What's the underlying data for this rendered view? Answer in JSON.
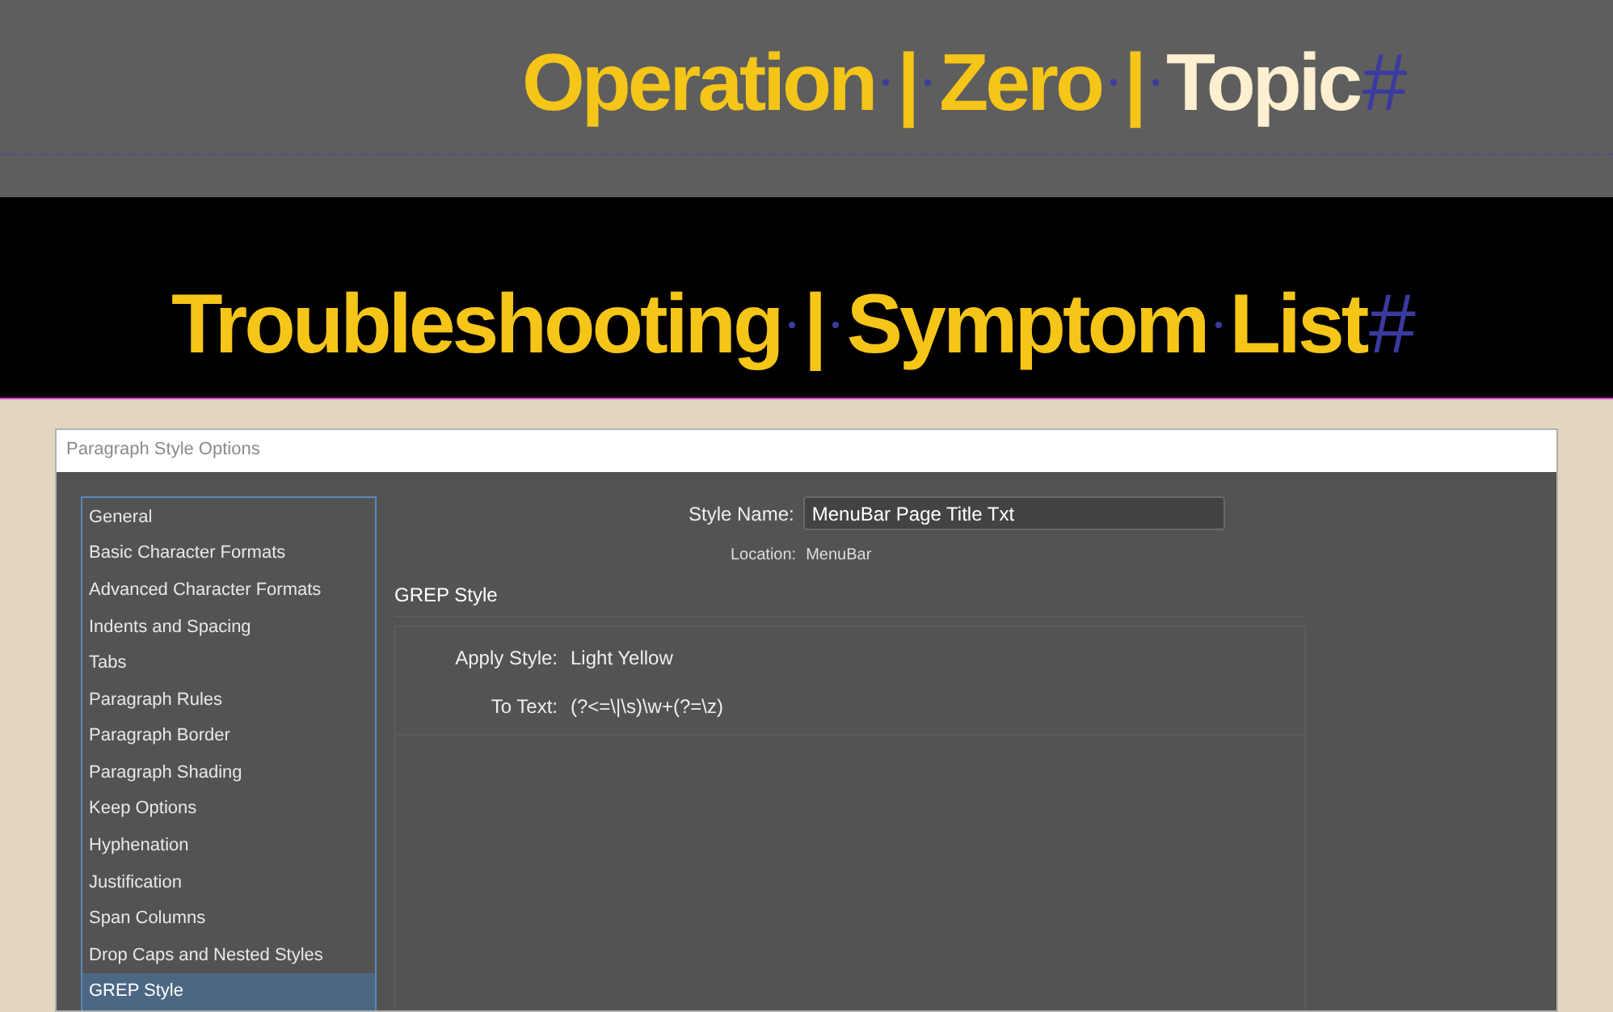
{
  "headline_top": [
    {
      "kind": "word",
      "text": "Operation",
      "color": "#f5c518"
    },
    {
      "kind": "space"
    },
    {
      "kind": "word",
      "text": "|",
      "color": "#f5c518"
    },
    {
      "kind": "space"
    },
    {
      "kind": "word",
      "text": "Zero",
      "color": "#f5c518"
    },
    {
      "kind": "space"
    },
    {
      "kind": "word",
      "text": "|",
      "color": "#f5c518"
    },
    {
      "kind": "space"
    },
    {
      "kind": "word",
      "text": "Topic",
      "color": "#fdefcf"
    },
    {
      "kind": "end",
      "text": "#"
    }
  ],
  "headline_banner": [
    {
      "kind": "word",
      "text": "Troubleshooting",
      "color": "#f5c518"
    },
    {
      "kind": "space"
    },
    {
      "kind": "word",
      "text": "|",
      "color": "#f5c518"
    },
    {
      "kind": "space"
    },
    {
      "kind": "word",
      "text": "Symptom",
      "color": "#f5c518"
    },
    {
      "kind": "space"
    },
    {
      "kind": "word",
      "text": "List",
      "color": "#f5c518"
    },
    {
      "kind": "end",
      "text": "#"
    }
  ],
  "dialog": {
    "title": "Paragraph Style Options",
    "sidebar": {
      "items": [
        {
          "label": "General",
          "selected": false
        },
        {
          "label": "Basic Character Formats",
          "selected": false
        },
        {
          "label": "Advanced Character Formats",
          "selected": false
        },
        {
          "label": "Indents and Spacing",
          "selected": false
        },
        {
          "label": "Tabs",
          "selected": false
        },
        {
          "label": "Paragraph Rules",
          "selected": false
        },
        {
          "label": "Paragraph Border",
          "selected": false
        },
        {
          "label": "Paragraph Shading",
          "selected": false
        },
        {
          "label": "Keep Options",
          "selected": false
        },
        {
          "label": "Hyphenation",
          "selected": false
        },
        {
          "label": "Justification",
          "selected": false
        },
        {
          "label": "Span Columns",
          "selected": false
        },
        {
          "label": "Drop Caps and Nested Styles",
          "selected": false
        },
        {
          "label": "GREP Style",
          "selected": true
        }
      ]
    },
    "style_name": {
      "label": "Style Name:",
      "value": "MenuBar Page Title Txt"
    },
    "location": {
      "label": "Location:",
      "value": "MenuBar"
    },
    "section_title": "GREP Style",
    "grep_rule": {
      "apply_style_label": "Apply Style:",
      "apply_style": "Light Yellow",
      "to_text_label": "To Text:",
      "to_text": "(?<=\\|\\s)\\w+(?=\\z)"
    }
  }
}
